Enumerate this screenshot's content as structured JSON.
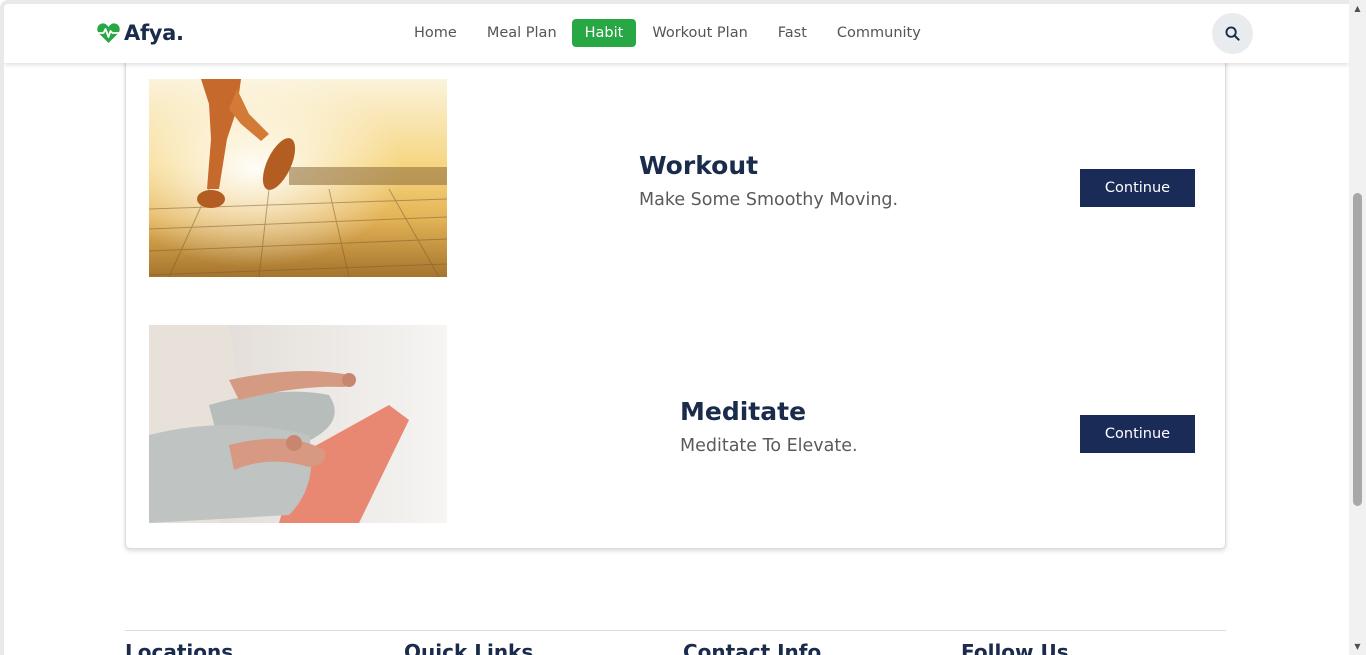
{
  "brand": {
    "name": "Afya.",
    "icon": "heartbeat-icon",
    "color": "#28a745"
  },
  "nav": {
    "items": [
      {
        "label": "Home",
        "active": false
      },
      {
        "label": "Meal Plan",
        "active": false
      },
      {
        "label": "Habit",
        "active": true
      },
      {
        "label": "Workout Plan",
        "active": false
      },
      {
        "label": "Fast",
        "active": false
      },
      {
        "label": "Community",
        "active": false
      }
    ],
    "search_icon": "search-icon",
    "active_color": "#28a745"
  },
  "habits": [
    {
      "title": "Workout",
      "subtitle": "Make Some Smoothy Moving.",
      "button": "Continue",
      "image": "runner-photo"
    },
    {
      "title": "Meditate",
      "subtitle": "Meditate To Elevate.",
      "button": "Continue",
      "image": "meditation-photo"
    }
  ],
  "footer": {
    "headings": [
      "Locations",
      "Quick Links",
      "Contact Info",
      "Follow Us"
    ]
  },
  "colors": {
    "primary_dark": "#1a2b57",
    "accent_green": "#28a745"
  }
}
